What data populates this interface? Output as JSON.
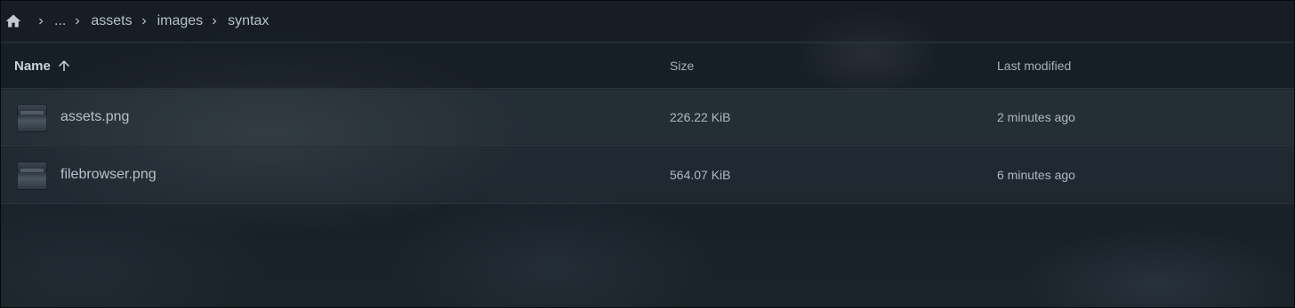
{
  "breadcrumb": {
    "home_icon": "home-icon",
    "separator_icon": "chevron-right-icon",
    "items": [
      "...",
      "assets",
      "images",
      "syntax"
    ]
  },
  "table": {
    "headers": {
      "name": "Name",
      "size": "Size",
      "modified": "Last modified"
    },
    "sort": {
      "column": "name",
      "direction": "ascending",
      "icon": "arrow-up-icon"
    },
    "rows": [
      {
        "name": "assets.png",
        "size": "226.22 KiB",
        "modified": "2 minutes ago",
        "icon": "image-thumbnail"
      },
      {
        "name": "filebrowser.png",
        "size": "564.07 KiB",
        "modified": "6 minutes ago",
        "icon": "image-thumbnail"
      }
    ]
  },
  "colors": {
    "background": "#1a222a",
    "text": "#c9d1d9",
    "muted_text": "#aeb7bf",
    "divider": "#2a333c"
  }
}
